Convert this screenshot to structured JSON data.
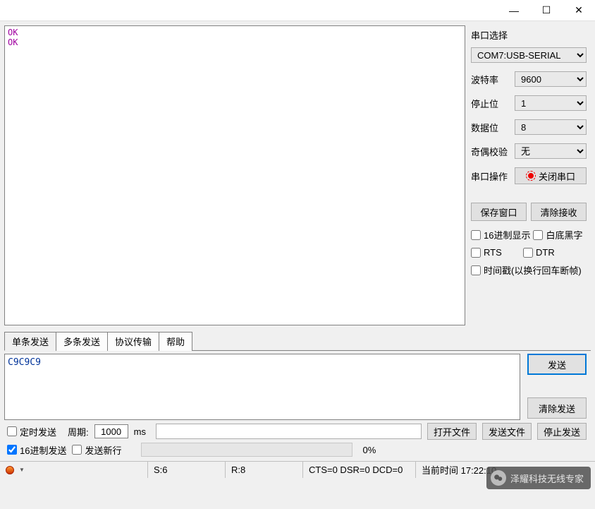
{
  "titlebar": {
    "min": "—",
    "max": "☐",
    "close": "✕"
  },
  "output": {
    "lines": [
      "OK",
      "OK"
    ]
  },
  "side": {
    "title": "串口选择",
    "port": {
      "value": "COM7:USB-SERIAL"
    },
    "baud": {
      "label": "波特率",
      "value": "9600"
    },
    "stop": {
      "label": "停止位",
      "value": "1"
    },
    "data": {
      "label": "数据位",
      "value": "8"
    },
    "parity": {
      "label": "奇偶校验",
      "value": "无"
    },
    "action": {
      "label": "串口操作",
      "button": "关闭串口"
    },
    "save_btn": "保存窗口",
    "clear_btn": "清除接收",
    "hex_display": "16进制显示",
    "white_bg": "白底黑字",
    "rts": "RTS",
    "dtr": "DTR",
    "timestamp": "时间戳(以换行回车断帧)"
  },
  "tabs": {
    "t0": "单条发送",
    "t1": "多条发送",
    "t2": "协议传输",
    "t3": "帮助"
  },
  "send": {
    "text": "C9C9C9",
    "send_btn": "发送",
    "clear_send_btn": "清除发送"
  },
  "opts": {
    "timed": "定时发送",
    "period_label": "周期:",
    "period_value": "1000",
    "period_unit": "ms",
    "open_file": "打开文件",
    "send_file": "发送文件",
    "stop_send": "停止发送",
    "hex_send": "16进制发送",
    "send_newline": "发送新行",
    "percent": "0%"
  },
  "status": {
    "s": "S:6",
    "r": "R:8",
    "cts": "CTS=0 DSR=0 DCD=0",
    "time": "当前时间 17:22:10"
  },
  "watermark": "泽耀科技无线专家"
}
